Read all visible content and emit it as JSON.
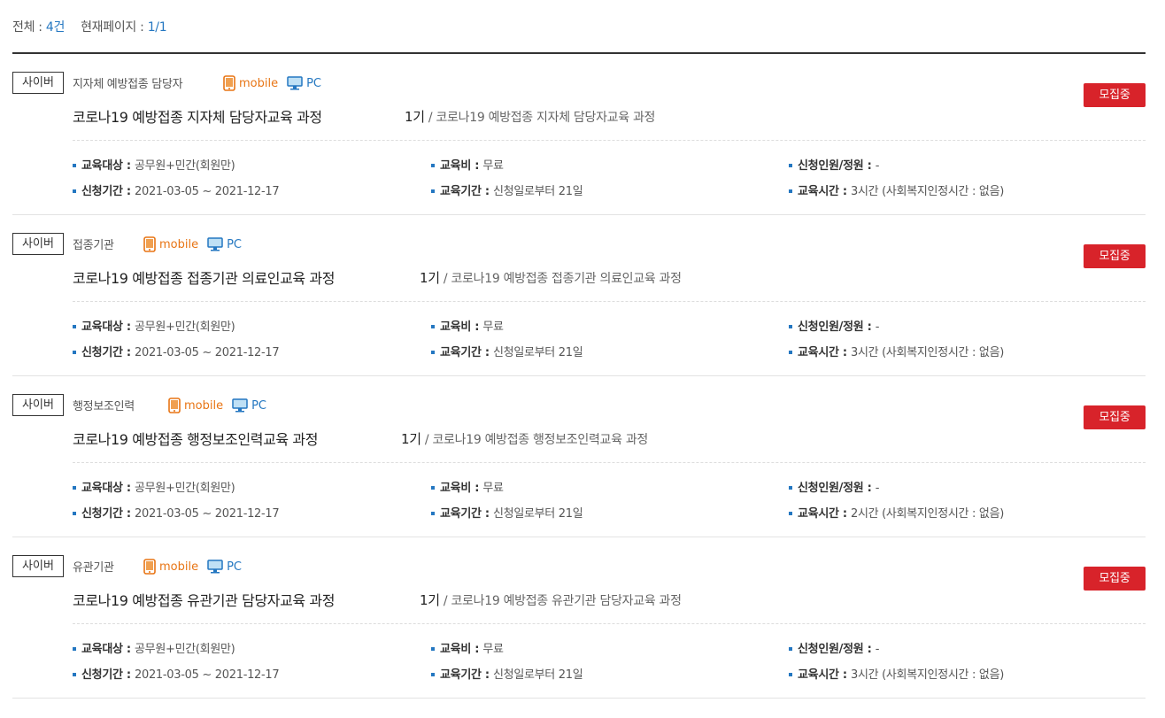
{
  "summary": {
    "total_label": "전체 : ",
    "total_value": "4건",
    "page_label": "현재페이지 : ",
    "page_value": "1/1"
  },
  "labels": {
    "target": "교육대상 : ",
    "fee": "교육비 : ",
    "capacity": "신청인원/정원 : ",
    "apply_period": "신청기간 : ",
    "edu_period": "교육기간 : ",
    "edu_time": "교육시간 : ",
    "mobile": "mobile",
    "pc": "PC"
  },
  "colors": {
    "accent": "#2477c1",
    "mobile": "#e87515",
    "status": "#d8232a"
  },
  "courses": [
    {
      "badge": "사이버",
      "org": "지자체 예방접종 담당자",
      "status": "모집중",
      "title": "코로나19 예방접종 지자체 담당자교육 과정",
      "term": "1기",
      "term_sub": " / 코로나19 예방접종 지자체 담당자교육 과정",
      "target": "공무원+민간(회원만)",
      "fee": "무료",
      "capacity": "-",
      "apply_period": "2021-03-05 ~ 2021-12-17",
      "edu_period": "신청일로부터 21일",
      "edu_time": "3시간 (사회복지인정시간 : 없음)"
    },
    {
      "badge": "사이버",
      "org": "접종기관",
      "status": "모집중",
      "title": "코로나19 예방접종 접종기관 의료인교육 과정",
      "term": "1기",
      "term_sub": " / 코로나19 예방접종 접종기관 의료인교육 과정",
      "target": "공무원+민간(회원만)",
      "fee": "무료",
      "capacity": "-",
      "apply_period": "2021-03-05 ~ 2021-12-17",
      "edu_period": "신청일로부터 21일",
      "edu_time": "3시간 (사회복지인정시간 : 없음)"
    },
    {
      "badge": "사이버",
      "org": "행정보조인력",
      "status": "모집중",
      "title": "코로나19 예방접종 행정보조인력교육 과정",
      "term": "1기",
      "term_sub": " / 코로나19 예방접종 행정보조인력교육 과정",
      "target": "공무원+민간(회원만)",
      "fee": "무료",
      "capacity": "-",
      "apply_period": "2021-03-05 ~ 2021-12-17",
      "edu_period": "신청일로부터 21일",
      "edu_time": "2시간 (사회복지인정시간 : 없음)"
    },
    {
      "badge": "사이버",
      "org": "유관기관",
      "status": "모집중",
      "title": "코로나19 예방접종 유관기관 담당자교육 과정",
      "term": "1기",
      "term_sub": " / 코로나19 예방접종 유관기관 담당자교육 과정",
      "target": "공무원+민간(회원만)",
      "fee": "무료",
      "capacity": "-",
      "apply_period": "2021-03-05 ~ 2021-12-17",
      "edu_period": "신청일로부터 21일",
      "edu_time": "3시간 (사회복지인정시간 : 없음)"
    }
  ]
}
